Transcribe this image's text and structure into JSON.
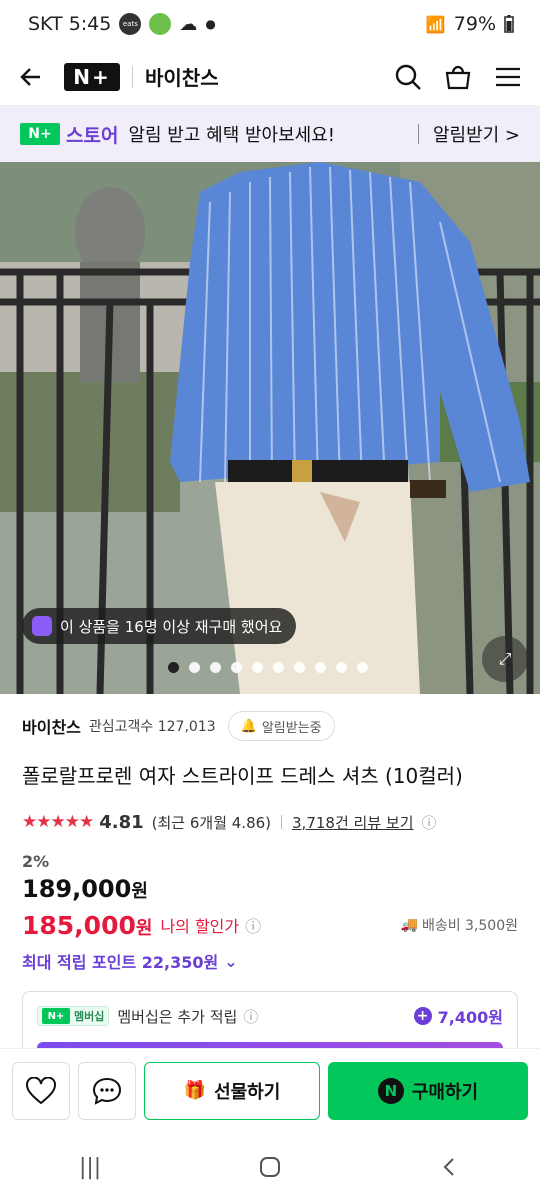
{
  "status": {
    "carrier_time": "SKT 5:45",
    "battery": "79%"
  },
  "header": {
    "shop_name": "바이찬스",
    "logo": "N+"
  },
  "banner": {
    "store": "스토어",
    "text": "알림 받고 혜택 받아보세요!",
    "action": "알림받기 >"
  },
  "hero": {
    "repurchase": "이 상품을 16명 이상 재구매 했어요",
    "total_slides": 10,
    "active_slide": 1
  },
  "seller": {
    "name": "바이찬스",
    "followers": "관심고객수 127,013",
    "follow_label": "알림받는중"
  },
  "product": {
    "title": "폴로랄프로렌 여자 스트라이프 드레스 셔츠 (10컬러)",
    "stars": "★★★★★",
    "score": "4.81",
    "recent": "(최근 6개월 4.86)",
    "reviews": "3,718건 리뷰 보기",
    "discount": "2%",
    "original_price": "189,000",
    "won": "원",
    "sale_price": "185,000",
    "my_discount": "나의 할인가",
    "shipping": "배송비 3,500원",
    "points": "최대 적립 포인트 22,350원"
  },
  "membership": {
    "badge": "멤버십",
    "text": "멤버십은 추가 적립",
    "points": "7,400원"
  },
  "actions": {
    "gift": "선물하기",
    "buy": "구매하기"
  },
  "colors": {
    "naver_green": "#03c75a",
    "accent_purple": "#6b3fd6",
    "sale_red": "#e5193e"
  }
}
